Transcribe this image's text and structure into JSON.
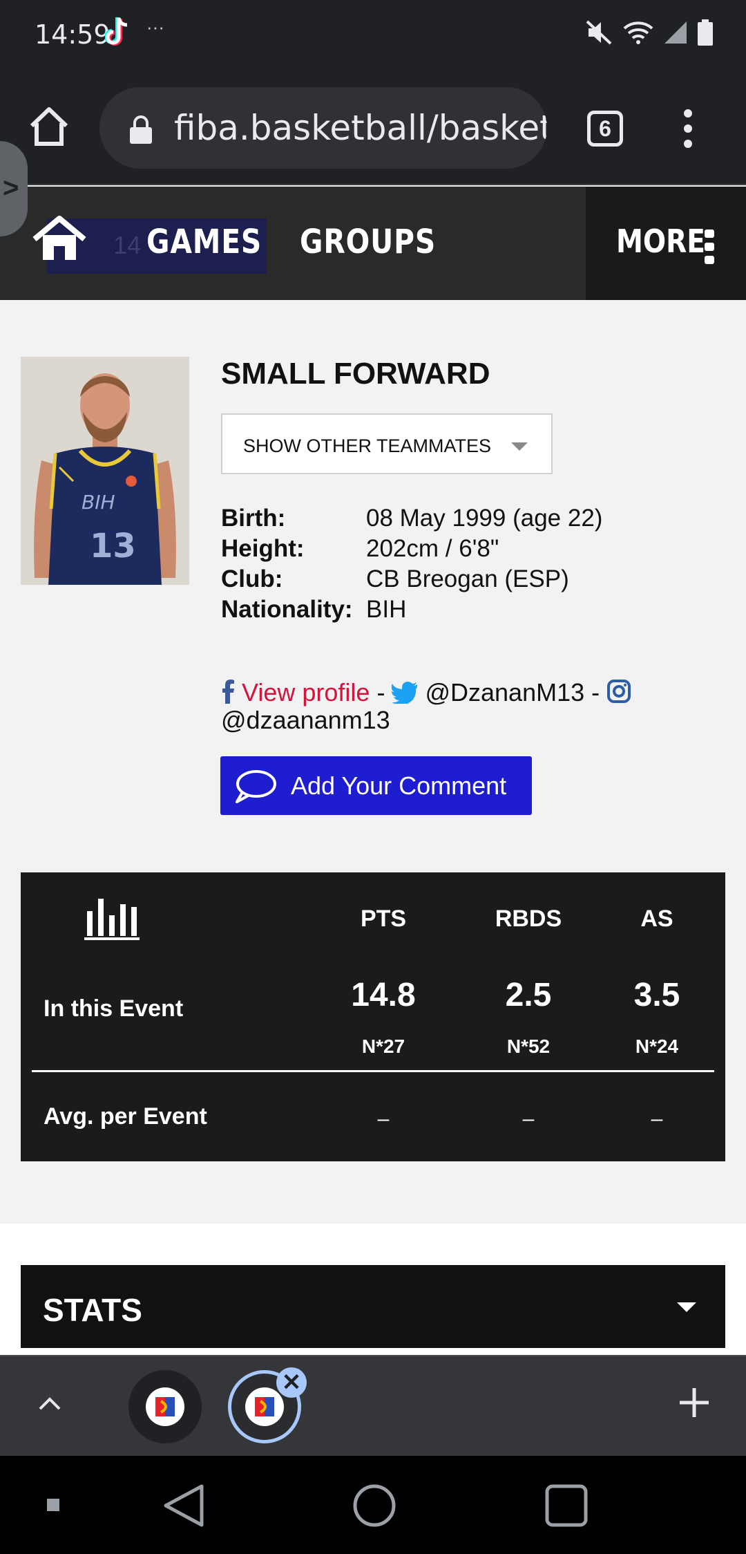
{
  "status_bar": {
    "time": "14:59",
    "more_indicator": "···"
  },
  "browser": {
    "url": "fiba.basketball/basket",
    "tab_count": "6"
  },
  "site_nav": {
    "ghost_text": "14",
    "items": [
      {
        "label": "GAMES"
      },
      {
        "label": "GROUPS"
      }
    ],
    "more_label": "MORE"
  },
  "player": {
    "position": "SMALL FORWARD",
    "teammates_select": "SHOW OTHER TEAMMATES",
    "info": [
      {
        "key": "Birth:",
        "value": "08 May 1999 (age 22)"
      },
      {
        "key": "Height:",
        "value": "202cm / 6'8\""
      },
      {
        "key": "Club:",
        "value": "CB Breogan (ESP)"
      },
      {
        "key": "Nationality:",
        "value": "BIH"
      }
    ],
    "social": {
      "view_profile": "View profile",
      "sep1": " - ",
      "twitter": "@DzananM13",
      "sep2": " - ",
      "instagram": "@dzaananm13"
    },
    "comment_button": "Add Your Comment"
  },
  "stats_card": {
    "headers": [
      "PTS",
      "RBDS",
      "AS"
    ],
    "rows": [
      {
        "label": "In this Event",
        "values": [
          "14.8",
          "2.5",
          "3.5"
        ],
        "ranks": [
          "N*27",
          "N*52",
          "N*24"
        ]
      },
      {
        "label": "Avg. per Event",
        "values": [
          "–",
          "–",
          "–"
        ]
      }
    ]
  },
  "stats_section": {
    "label": "STATS"
  },
  "colors": {
    "accent_blue": "#1e1ed0",
    "link_red": "#d4143b",
    "facebook": "#3b5998",
    "twitter": "#1da1f2",
    "instagram": "#2b5ea8"
  },
  "icons": [
    "home-icon",
    "lock-icon",
    "kebab-menu-icon",
    "chart-icon",
    "comment-icon",
    "facebook-icon",
    "twitter-icon",
    "instagram-icon",
    "chevron-up-icon",
    "plus-icon"
  ]
}
